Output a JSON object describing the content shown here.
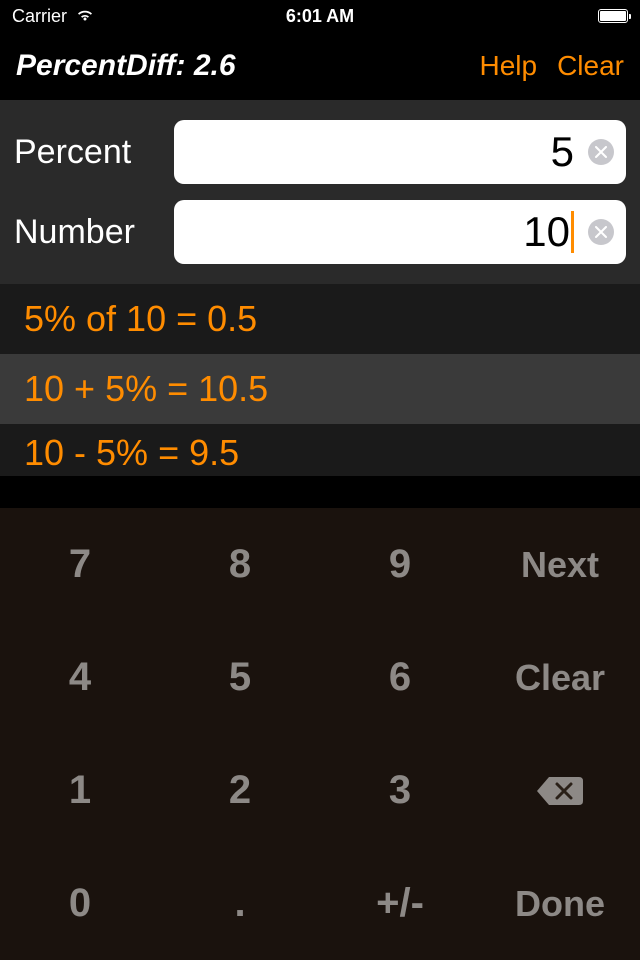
{
  "status": {
    "carrier": "Carrier",
    "time": "6:01 AM"
  },
  "nav": {
    "title": "PercentDiff: 2.6",
    "help_label": "Help",
    "clear_label": "Clear"
  },
  "inputs": {
    "percent_label": "Percent",
    "percent_value": "5",
    "number_label": "Number",
    "number_value": "10"
  },
  "results": [
    "5% of 10 = 0.5",
    "10 + 5% = 10.5",
    "10 - 5% = 9.5"
  ],
  "keypad": {
    "k7": "7",
    "k8": "8",
    "k9": "9",
    "next": "Next",
    "k4": "4",
    "k5": "5",
    "k6": "6",
    "clear": "Clear",
    "k1": "1",
    "k2": "2",
    "k3": "3",
    "k0": "0",
    "kdot": ".",
    "kpm": "+/-",
    "done": "Done"
  }
}
